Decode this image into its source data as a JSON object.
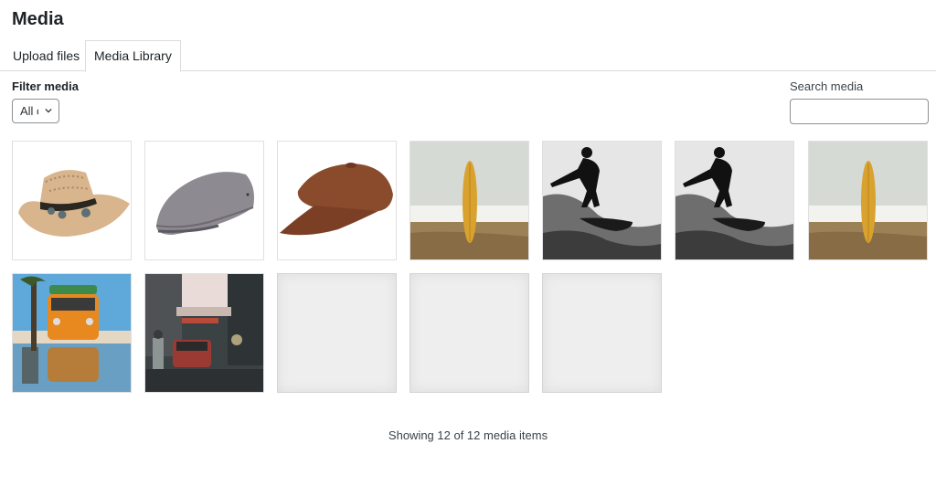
{
  "page": {
    "title": "Media"
  },
  "tabs": [
    {
      "label": "Upload files",
      "active": false
    },
    {
      "label": "Media Library",
      "active": true
    }
  ],
  "filter": {
    "label": "Filter media",
    "selected": "All media items",
    "selected_visible": "All c",
    "icon": "chevron-down-icon"
  },
  "search": {
    "label": "Search media",
    "value": "",
    "placeholder": ""
  },
  "media_items": [
    {
      "subject": "straw cowboy hat",
      "kind": "image"
    },
    {
      "subject": "grey flat cap",
      "kind": "image"
    },
    {
      "subject": "brown newsboy cap",
      "kind": "image"
    },
    {
      "subject": "yellow surfboard on beach",
      "kind": "image"
    },
    {
      "subject": "surfer silhouette on wave",
      "kind": "image"
    },
    {
      "subject": "surfer silhouette on wave",
      "kind": "image"
    },
    {
      "subject": "yellow surfboard on beach",
      "kind": "image"
    },
    {
      "subject": "orange van by palm trees",
      "kind": "image"
    },
    {
      "subject": "city street with taxi",
      "kind": "image"
    },
    {
      "subject": "loading placeholder",
      "kind": "placeholder"
    },
    {
      "subject": "loading placeholder",
      "kind": "placeholder"
    },
    {
      "subject": "loading placeholder",
      "kind": "placeholder"
    }
  ],
  "status": {
    "text": "Showing 12 of 12 media items",
    "shown": 12,
    "total": 12
  }
}
